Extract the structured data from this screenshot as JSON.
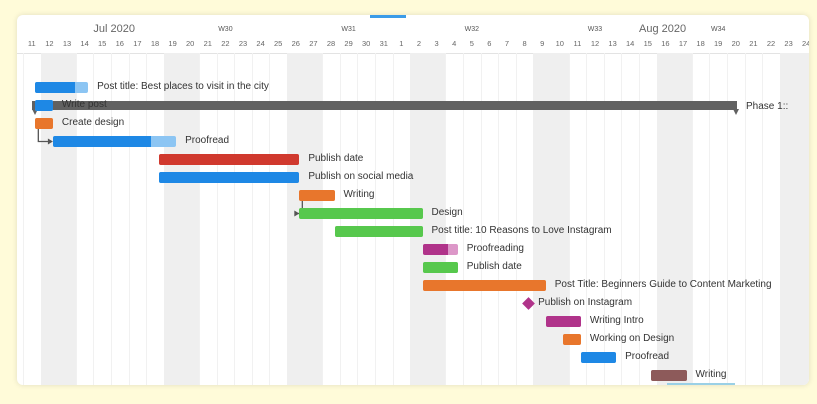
{
  "timeline": {
    "months": [
      {
        "label": "Jul 2020",
        "day_index": 4
      },
      {
        "label": "Aug 2020",
        "day_index": 35
      }
    ],
    "weeks": [
      {
        "label": "W30",
        "day_index": 11
      },
      {
        "label": "W31",
        "day_index": 18
      },
      {
        "label": "W32",
        "day_index": 25
      },
      {
        "label": "W33",
        "day_index": 32
      },
      {
        "label": "W34",
        "day_index": 39
      }
    ],
    "days": [
      "11",
      "12",
      "13",
      "14",
      "15",
      "16",
      "17",
      "18",
      "19",
      "20",
      "21",
      "22",
      "23",
      "24",
      "25",
      "26",
      "27",
      "28",
      "29",
      "30",
      "31",
      "1",
      "2",
      "3",
      "4",
      "5",
      "6",
      "7",
      "8",
      "9",
      "10",
      "11",
      "12",
      "13",
      "14",
      "15",
      "16",
      "17",
      "18",
      "19",
      "20",
      "21",
      "22",
      "23",
      "24"
    ]
  },
  "phase": {
    "label": "Phase 1::",
    "color": "#616161"
  },
  "tasks": [
    {
      "name": "Post title: Best places to visit in the city",
      "type": "bar",
      "start": 0.7,
      "end": 3.7,
      "progress": 0.75,
      "color": "#1e88e5",
      "light": "#8cc5f3"
    },
    {
      "name": "Write post",
      "type": "bar",
      "start": 0.7,
      "end": 1.7,
      "progress": 1,
      "color": "#1e88e5",
      "light": "#8cc5f3"
    },
    {
      "name": "Create design",
      "type": "bar",
      "start": 0.7,
      "end": 1.7,
      "progress": 1,
      "color": "#e8762c",
      "light": "#f4b88f"
    },
    {
      "name": "Proofread",
      "type": "bar",
      "start": 1.7,
      "end": 8.7,
      "progress": 0.8,
      "color": "#1e88e5",
      "light": "#8cc5f3"
    },
    {
      "name": "Publish date",
      "type": "bar",
      "start": 7.7,
      "end": 15.7,
      "progress": 1,
      "color": "#d0392e",
      "light": "#e8928c"
    },
    {
      "name": "Publish on social media",
      "type": "bar",
      "start": 7.7,
      "end": 15.7,
      "progress": 1,
      "color": "#1e88e5",
      "light": "#8cc5f3"
    },
    {
      "name": "Writing",
      "type": "bar",
      "start": 15.7,
      "end": 17.7,
      "progress": 1,
      "color": "#e8762c",
      "light": "#f4b88f"
    },
    {
      "name": "Design",
      "type": "bar",
      "start": 15.7,
      "end": 22.7,
      "progress": 1,
      "color": "#57c84d",
      "light": "#a8e3a3"
    },
    {
      "name": "Post title: 10 Reasons to Love Instagram",
      "type": "bar",
      "start": 17.7,
      "end": 22.7,
      "progress": 1,
      "color": "#57c84d",
      "light": "#a8e3a3"
    },
    {
      "name": "Proofreading",
      "type": "bar",
      "start": 22.7,
      "end": 24.7,
      "progress": 0.72,
      "color": "#b0338a",
      "light": "#dc97c8"
    },
    {
      "name": "Publish date",
      "type": "bar",
      "start": 22.7,
      "end": 24.7,
      "progress": 1,
      "color": "#57c84d",
      "light": "#a8e3a3"
    },
    {
      "name": "Post Title: Beginners Guide to Content Marketing",
      "type": "bar",
      "start": 22.7,
      "end": 29.7,
      "progress": 1,
      "color": "#e8762c",
      "light": "#f4b88f"
    },
    {
      "name": "Publish on Instagram",
      "type": "milestone",
      "start": 28.7,
      "end": 28.7,
      "progress": 1,
      "color": "#b0338a",
      "light": "#dc97c8"
    },
    {
      "name": "Writing Intro",
      "type": "bar",
      "start": 29.7,
      "end": 31.7,
      "progress": 1,
      "color": "#b0338a",
      "light": "#dc97c8"
    },
    {
      "name": "Working on Design",
      "type": "bar",
      "start": 30.7,
      "end": 31.7,
      "progress": 1,
      "color": "#e8762c",
      "light": "#f4b88f"
    },
    {
      "name": "Proofread",
      "type": "bar",
      "start": 31.7,
      "end": 33.7,
      "progress": 1,
      "color": "#1e88e5",
      "light": "#8cc5f3"
    },
    {
      "name": "Writing",
      "type": "bar",
      "start": 35.7,
      "end": 37.7,
      "progress": 1,
      "color": "#8d5a5a",
      "light": "#c9a3a3"
    }
  ],
  "dependencies": [
    {
      "from": 2,
      "to": 3
    },
    {
      "from": 6,
      "to": 7
    }
  ]
}
